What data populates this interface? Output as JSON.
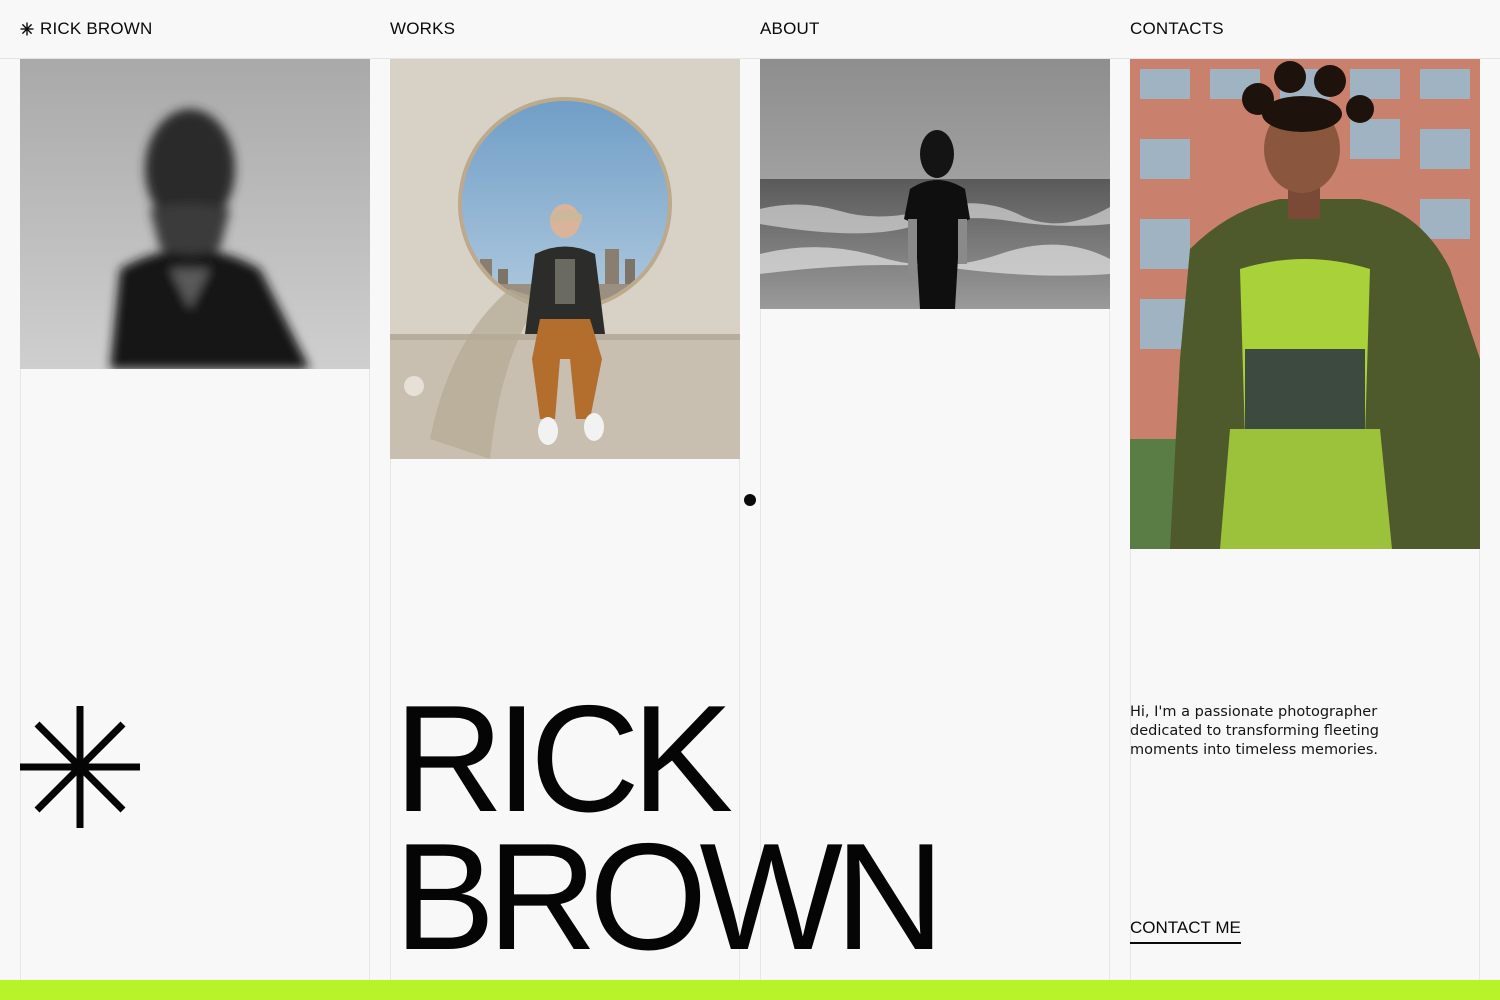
{
  "brand": {
    "name": "RICK BROWN",
    "accent": "#b8f229"
  },
  "nav": {
    "works": "WORKS",
    "about": "ABOUT",
    "contacts": "CONTACTS"
  },
  "hero": {
    "line1": "RICK",
    "line2": "BROWN"
  },
  "bio": "Hi, I'm a passionate photographer dedicated to transforming fleeting moments into timeless memories.",
  "cta": {
    "label": "CONTACT ME"
  },
  "icons": {
    "logo": "asterisk-icon",
    "hero": "asterisk-icon"
  }
}
